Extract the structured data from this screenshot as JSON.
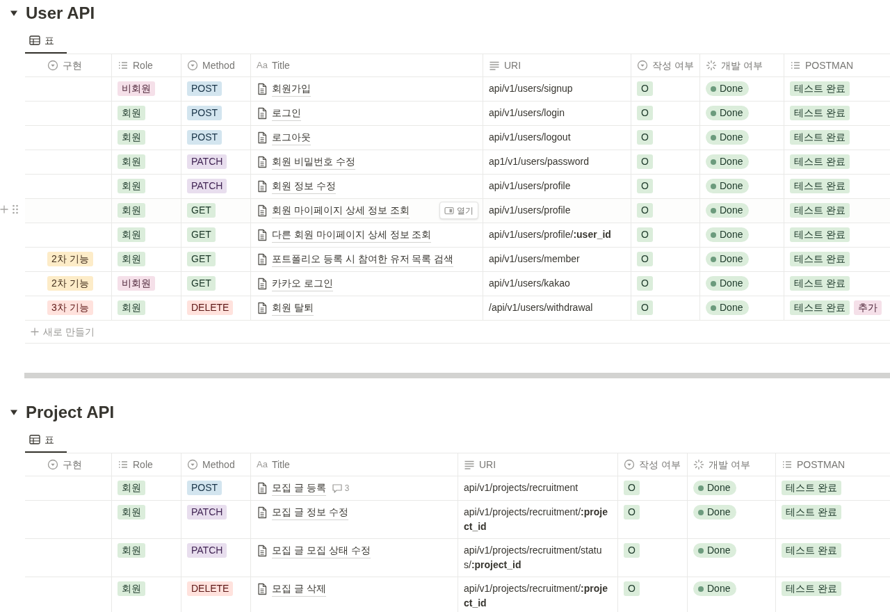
{
  "sections": [
    {
      "title": "User API",
      "expanded": true,
      "view_tab": {
        "label": "표",
        "selected": true
      },
      "columns": [
        {
          "label": "구현",
          "kind": "select"
        },
        {
          "label": "Role",
          "kind": "multi"
        },
        {
          "label": "Method",
          "kind": "select"
        },
        {
          "label": "Title",
          "kind": "title",
          "prefix": "Aa"
        },
        {
          "label": "URI",
          "kind": "text"
        },
        {
          "label": "작성 여부",
          "kind": "select"
        },
        {
          "label": "개발 여부",
          "kind": "status"
        },
        {
          "label": "POSTMAN",
          "kind": "multi"
        }
      ],
      "rows": [
        {
          "role": [
            {
              "text": "비회원",
              "color": "#f5e0e9"
            }
          ],
          "method": {
            "text": "POST",
            "color": "#d3e5ef"
          },
          "title": "회원가입",
          "uri": "api/v1/users/signup",
          "written": {
            "text": "O",
            "color": "#dbeddb"
          },
          "status": {
            "text": "Done",
            "color": "#dbeddb"
          },
          "postman": [
            {
              "text": "테스트 완료",
              "color": "#dbeddb"
            }
          ],
          "hovered": false
        },
        {
          "role": [
            {
              "text": "회원",
              "color": "#dbeddb"
            }
          ],
          "method": {
            "text": "POST",
            "color": "#d3e5ef"
          },
          "title": "로그인",
          "uri": "api/v1/users/login",
          "written": {
            "text": "O",
            "color": "#dbeddb"
          },
          "status": {
            "text": "Done",
            "color": "#dbeddb"
          },
          "postman": [
            {
              "text": "테스트 완료",
              "color": "#dbeddb"
            }
          ],
          "hovered": false
        },
        {
          "role": [
            {
              "text": "회원",
              "color": "#dbeddb"
            }
          ],
          "method": {
            "text": "POST",
            "color": "#d3e5ef"
          },
          "title": "로그아웃",
          "uri": "api/v1/users/logout",
          "written": {
            "text": "O",
            "color": "#dbeddb"
          },
          "status": {
            "text": "Done",
            "color": "#dbeddb"
          },
          "postman": [
            {
              "text": "테스트 완료",
              "color": "#dbeddb"
            }
          ],
          "hovered": false
        },
        {
          "role": [
            {
              "text": "회원",
              "color": "#dbeddb"
            }
          ],
          "method": {
            "text": "PATCH",
            "color": "#e8deee"
          },
          "title": "회원 비밀번호 수정",
          "uri": "ap1/v1/users/password",
          "written": {
            "text": "O",
            "color": "#dbeddb"
          },
          "status": {
            "text": "Done",
            "color": "#dbeddb"
          },
          "postman": [
            {
              "text": "테스트 완료",
              "color": "#dbeddb"
            }
          ],
          "hovered": false
        },
        {
          "role": [
            {
              "text": "회원",
              "color": "#dbeddb"
            }
          ],
          "method": {
            "text": "PATCH",
            "color": "#e8deee"
          },
          "title": "회원 정보 수정",
          "uri": "api/v1/users/profile",
          "written": {
            "text": "O",
            "color": "#dbeddb"
          },
          "status": {
            "text": "Done",
            "color": "#dbeddb"
          },
          "postman": [
            {
              "text": "테스트 완료",
              "color": "#dbeddb"
            }
          ],
          "hovered": false
        },
        {
          "role": [
            {
              "text": "회원",
              "color": "#dbeddb"
            }
          ],
          "method": {
            "text": "GET",
            "color": "#dbeddb"
          },
          "title": "회원 마이페이지 상세 정보 조회",
          "open_button": "열기",
          "uri": "api/v1/users/profile",
          "written": {
            "text": "O",
            "color": "#dbeddb"
          },
          "status": {
            "text": "Done",
            "color": "#dbeddb"
          },
          "postman": [
            {
              "text": "테스트 완료",
              "color": "#dbeddb"
            }
          ],
          "hovered": true
        },
        {
          "role": [
            {
              "text": "회원",
              "color": "#dbeddb"
            }
          ],
          "method": {
            "text": "GET",
            "color": "#dbeddb"
          },
          "title": "다른 회원 마이페이지 상세 정보 조회",
          "uri": "api/v1/users/profile/**:user_id**",
          "written": {
            "text": "O",
            "color": "#dbeddb"
          },
          "status": {
            "text": "Done",
            "color": "#dbeddb"
          },
          "postman": [
            {
              "text": "테스트 완료",
              "color": "#dbeddb"
            }
          ],
          "hovered": false
        },
        {
          "stage": {
            "text": "2차 기능",
            "color": "#fdecc8"
          },
          "role": [
            {
              "text": "회원",
              "color": "#dbeddb"
            }
          ],
          "method": {
            "text": "GET",
            "color": "#dbeddb"
          },
          "title": "포트폴리오 등록 시 참여한 유저 목록 검색",
          "uri": "api/v1/users/member",
          "written": {
            "text": "O",
            "color": "#dbeddb"
          },
          "status": {
            "text": "Done",
            "color": "#dbeddb"
          },
          "postman": [
            {
              "text": "테스트 완료",
              "color": "#dbeddb"
            }
          ],
          "hovered": false
        },
        {
          "stage": {
            "text": "2차 기능",
            "color": "#fdecc8"
          },
          "role": [
            {
              "text": "비회원",
              "color": "#f5e0e9"
            }
          ],
          "method": {
            "text": "GET",
            "color": "#dbeddb"
          },
          "title": "카카오 로그인",
          "uri": "api/v1/users/kakao",
          "written": {
            "text": "O",
            "color": "#dbeddb"
          },
          "status": {
            "text": "Done",
            "color": "#dbeddb"
          },
          "postman": [
            {
              "text": "테스트 완료",
              "color": "#dbeddb"
            }
          ],
          "hovered": false
        },
        {
          "stage": {
            "text": "3차 기능",
            "color": "#ffe2dd"
          },
          "role": [
            {
              "text": "회원",
              "color": "#dbeddb"
            }
          ],
          "method": {
            "text": "DELETE",
            "color": "#ffe2dd"
          },
          "title": "회원 탈퇴",
          "uri": "/api/v1/users/withdrawal",
          "written": {
            "text": "O",
            "color": "#dbeddb"
          },
          "status": {
            "text": "Done",
            "color": "#dbeddb"
          },
          "postman": [
            {
              "text": "테스트 완료",
              "color": "#dbeddb"
            },
            {
              "text": "추가",
              "color": "#f5e0e9"
            }
          ],
          "hovered": false
        }
      ],
      "new_row": "새로 만들기"
    },
    {
      "title": "Project API",
      "expanded": true,
      "view_tab": {
        "label": "표",
        "selected": true
      },
      "columns": [
        {
          "label": "구현",
          "kind": "select"
        },
        {
          "label": "Role",
          "kind": "multi"
        },
        {
          "label": "Method",
          "kind": "select"
        },
        {
          "label": "Title",
          "kind": "title",
          "prefix": "Aa"
        },
        {
          "label": "URI",
          "kind": "text"
        },
        {
          "label": "작성 여부",
          "kind": "select"
        },
        {
          "label": "개발 여부",
          "kind": "status"
        },
        {
          "label": "POSTMAN",
          "kind": "multi"
        }
      ],
      "rows": [
        {
          "role": [
            {
              "text": "회원",
              "color": "#dbeddb"
            }
          ],
          "method": {
            "text": "POST",
            "color": "#d3e5ef"
          },
          "title": "모집 글 등록",
          "comments": "3",
          "uri": "api/v1/projects/recruitment",
          "written": {
            "text": "O",
            "color": "#dbeddb"
          },
          "status": {
            "text": "Done",
            "color": "#dbeddb"
          },
          "postman": [
            {
              "text": "테스트 완료",
              "color": "#dbeddb"
            }
          ],
          "hovered": false
        },
        {
          "role": [
            {
              "text": "회원",
              "color": "#dbeddb"
            }
          ],
          "method": {
            "text": "PATCH",
            "color": "#e8deee"
          },
          "title": "모집 글 정보 수정",
          "uri": "api/v1/projects/recruitment/**:project_id**",
          "written": {
            "text": "O",
            "color": "#dbeddb"
          },
          "status": {
            "text": "Done",
            "color": "#dbeddb"
          },
          "postman": [
            {
              "text": "테스트 완료",
              "color": "#dbeddb"
            }
          ],
          "hovered": false
        },
        {
          "role": [
            {
              "text": "회원",
              "color": "#dbeddb"
            }
          ],
          "method": {
            "text": "PATCH",
            "color": "#e8deee"
          },
          "title": "모집 글 모집 상태 수정",
          "uri": "api/v1/projects/recruitment/status/**:project_id**",
          "written": {
            "text": "O",
            "color": "#dbeddb"
          },
          "status": {
            "text": "Done",
            "color": "#dbeddb"
          },
          "postman": [
            {
              "text": "테스트 완료",
              "color": "#dbeddb"
            }
          ],
          "hovered": false
        },
        {
          "role": [
            {
              "text": "회원",
              "color": "#dbeddb"
            }
          ],
          "method": {
            "text": "DELETE",
            "color": "#ffe2dd"
          },
          "title": "모집 글 삭제",
          "uri": "api/v1/projects/recruitment/**:project_id**",
          "written": {
            "text": "O",
            "color": "#dbeddb"
          },
          "status": {
            "text": "Done",
            "color": "#dbeddb"
          },
          "postman": [
            {
              "text": "테스트 완료",
              "color": "#dbeddb"
            }
          ],
          "hovered": false
        }
      ]
    }
  ]
}
